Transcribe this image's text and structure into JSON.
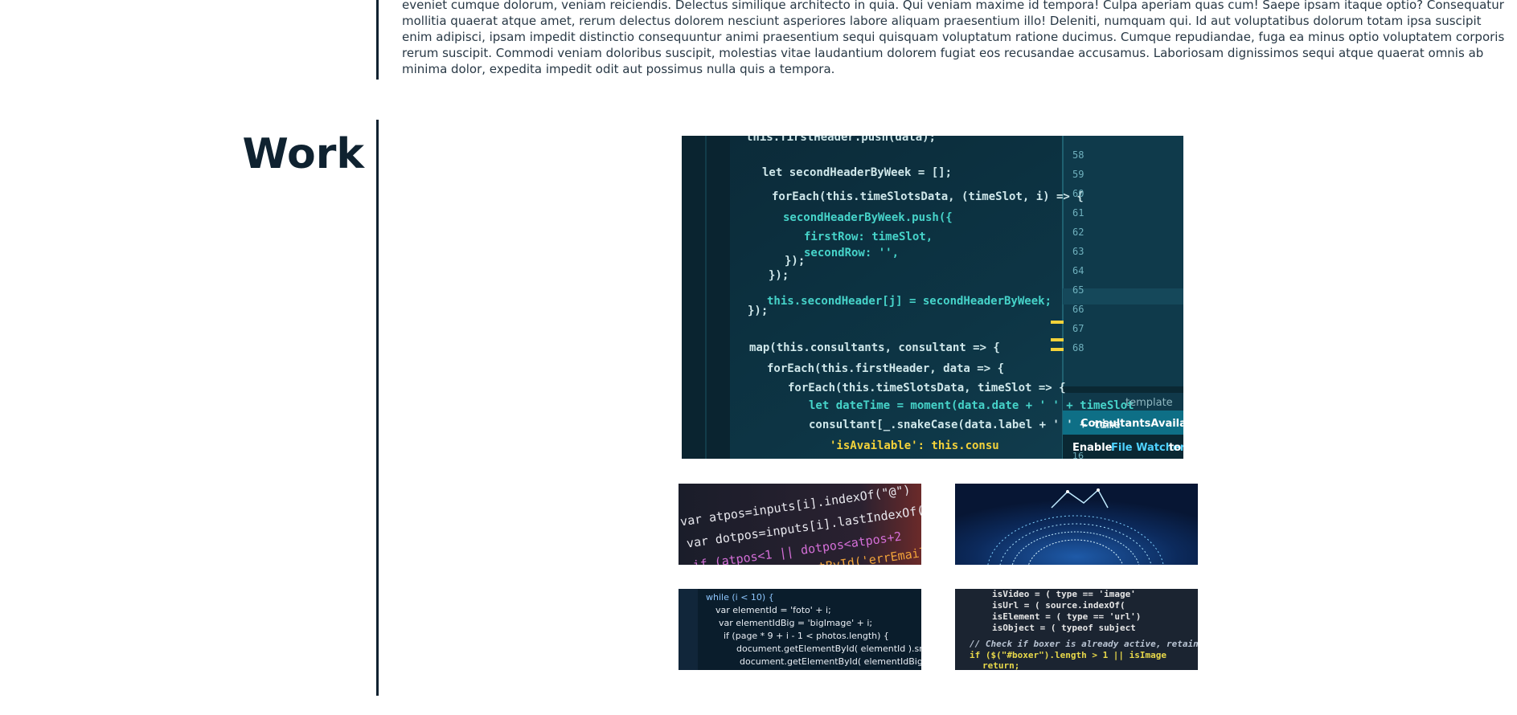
{
  "about": {
    "paragraph": "eveniet cumque dolorum, veniam reiciendis. Delectus similique architecto in quia. Qui veniam maxime id tempora! Culpa aperiam quas cum! Saepe ipsam itaque optio? Consequatur mollitia quaerat atque amet, rerum delectus dolorem nesciunt asperiores labore aliquam praesentium illo! Deleniti, numquam qui. Id aut voluptatibus dolorum totam ipsa suscipit enim adipisci, ipsam impedit distinctio consequuntur animi praesentium sequi quisquam voluptatum ratione ducimus. Cumque repudiandae, fuga ea minus optio voluptatem corporis rerum suscipit. Commodi veniam doloribus suscipit, molestias vitae laudantium dolorem fugiat eos recusandae accusamus. Laboriosam dignissimos sequi atque quaerat omnis ab minima dolor, expedita impedit odit aut possimus nulla quis a tempora."
  },
  "work": {
    "title": "Work",
    "main_image": {
      "icon": "code-editor-image",
      "code_lines": [
        "this.firstHeader.push(data);",
        "let secondHeaderByWeek = [];",
        "forEach(this.timeSlotsData, (timeSlot, i) => {",
        "secondHeaderByWeek.push({",
        "firstRow: timeSlot,",
        "secondRow: '',",
        "});",
        "});",
        "this.secondHeader[j] = secondHeaderByWeek;",
        "});",
        "map(this.consultants, consultant => {",
        "forEach(this.firstHeader, data => {",
        "forEach(this.timeSlotsData, timeSlot => {",
        "let dateTime = moment(data.date + ' ' + timeSlot",
        "consultant[_.snakeCase(data.label + ' ' + time",
        "'isAvailable': this.consu"
      ],
      "line_numbers": [
        "58",
        "59",
        "60",
        "61",
        "62",
        "63",
        "64",
        "65",
        "66",
        "67",
        "68"
      ],
      "panel_tab": "template",
      "panel_title": "ConsultantsAvailabil",
      "panel_text_1": "Enable",
      "panel_text_2": "File Watcher",
      "panel_text_3": "to",
      "panel_number": "16"
    },
    "thumbs": [
      {
        "icon": "js-code-image",
        "lines": [
          "var atpos=inputs[i].indexOf(\"@\")",
          "var dotpos=inputs[i].lastIndexOf(\".\"",
          "if (atpos<1 || dotpos<atpos+2",
          "ment.getElementById('errEmail'"
        ]
      },
      {
        "icon": "digital-globe-image"
      },
      {
        "icon": "photo-code-image",
        "lines": [
          "while (i < 10) {",
          "var elementId = 'foto' + i;",
          "var elementIdBig = 'bigImage' + i;",
          "if (page * 9 + i - 1 < photos.length) {",
          "document.getElementById( elementId ).src =",
          "document.getElementById( elementIdBig ).src ="
        ]
      },
      {
        "icon": "boxer-code-image",
        "lines": [
          "isVideo = ( type == 'image'",
          "isUrl   = ( source.indexOf(",
          "isElement = ( type == 'url')",
          "isObject  = ( typeof subject",
          "// Check if boxer is already active, retain",
          "if ($(\"#boxer\").length > 1 || isImage",
          "return;"
        ]
      }
    ]
  }
}
